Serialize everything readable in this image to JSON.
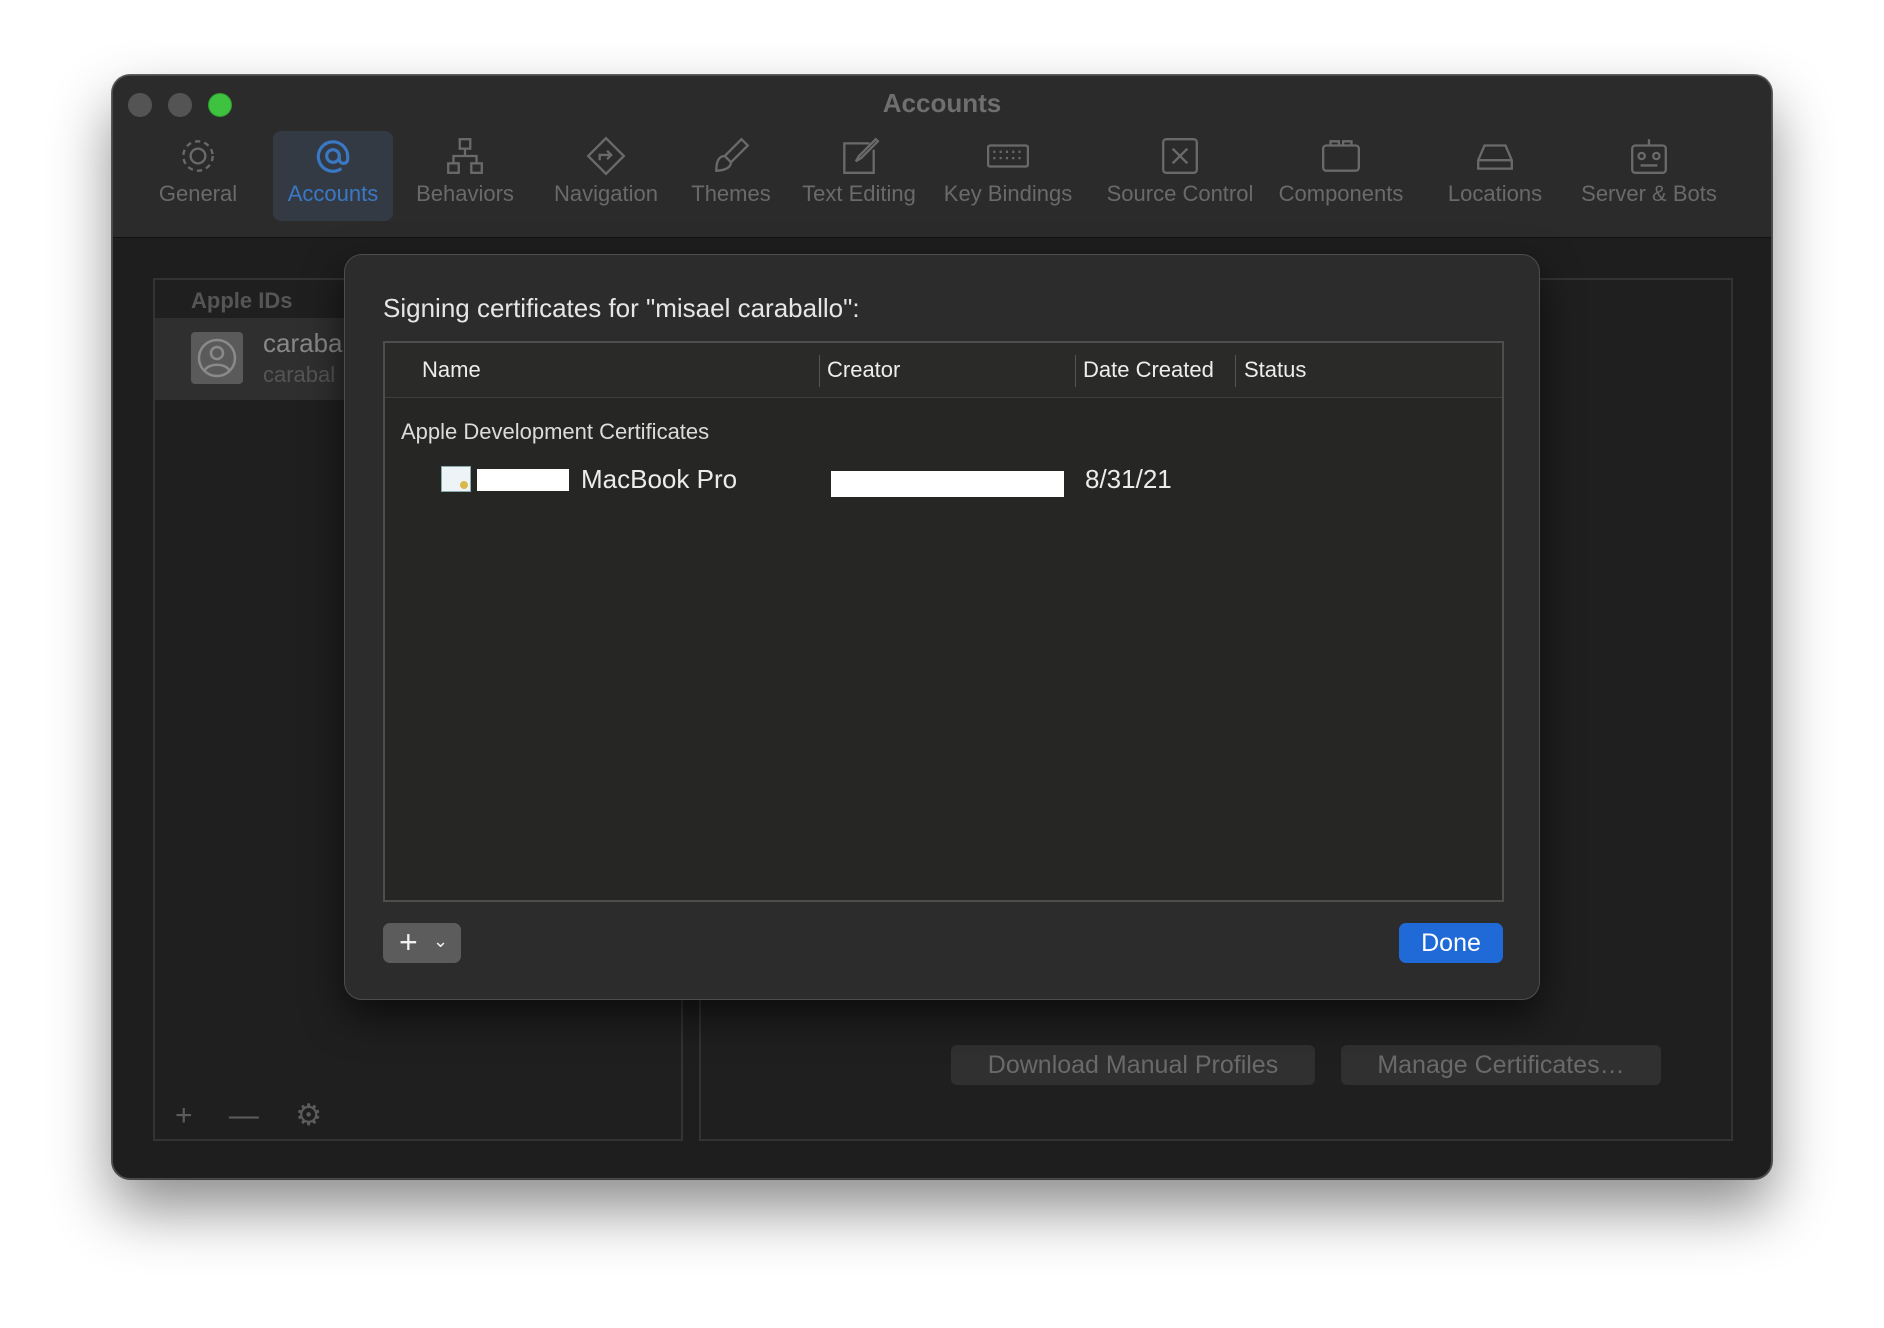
{
  "window": {
    "title": "Accounts"
  },
  "toolbar": {
    "items": [
      {
        "label": "General",
        "icon": "gear-icon"
      },
      {
        "label": "Accounts",
        "icon": "at-icon"
      },
      {
        "label": "Behaviors",
        "icon": "hierarchy-icon"
      },
      {
        "label": "Navigation",
        "icon": "diamond-arrow-icon"
      },
      {
        "label": "Themes",
        "icon": "brush-icon"
      },
      {
        "label": "Text Editing",
        "icon": "pencil-square-icon"
      },
      {
        "label": "Key Bindings",
        "icon": "keyboard-icon"
      },
      {
        "label": "Source Control",
        "icon": "source-control-icon"
      },
      {
        "label": "Components",
        "icon": "components-icon"
      },
      {
        "label": "Locations",
        "icon": "drive-icon"
      },
      {
        "label": "Server & Bots",
        "icon": "robot-icon"
      }
    ],
    "active": "Accounts"
  },
  "sidebar": {
    "heading": "Apple IDs",
    "account_name": "caraba",
    "account_sub": "carabal",
    "add": "+",
    "remove": "—",
    "settings": "⚙"
  },
  "detail": {
    "download_profiles": "Download Manual Profiles",
    "manage_certificates": "Manage Certificates…"
  },
  "sheet": {
    "title": "Signing certificates for \"misael caraballo\":",
    "columns": [
      "Name",
      "Creator",
      "Date Created",
      "Status"
    ],
    "group": "Apple Development Certificates",
    "rows": [
      {
        "name": "MacBook Pro",
        "creator": "",
        "date": "8/31/21",
        "status": ""
      }
    ],
    "add_label": "+",
    "add_chevron": "⌄",
    "done_label": "Done"
  },
  "colors": {
    "accent": "#1f6ad6",
    "maximize": "#3fc23f"
  }
}
